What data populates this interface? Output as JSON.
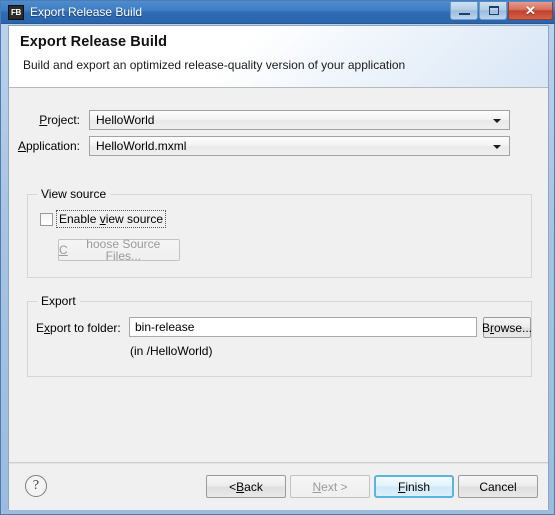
{
  "window": {
    "title": "Export Release Build",
    "icon_label": "FB",
    "icon_name": "flash-builder-icon",
    "controls": {
      "minimize": "minimize-icon",
      "maximize": "restore-icon",
      "close": "✕"
    }
  },
  "banner": {
    "title": "Export Release Build",
    "subtitle": "Build and export an optimized release-quality version of your application"
  },
  "form": {
    "project": {
      "label_pre": "",
      "label_mnemonic": "P",
      "label_post": "roject:",
      "value": "HelloWorld"
    },
    "application": {
      "label_pre": "",
      "label_mnemonic": "A",
      "label_post": "pplication:",
      "value": "HelloWorld.mxml"
    }
  },
  "view_source": {
    "legend": "View source",
    "checkbox": {
      "label_pre": "Enable ",
      "label_mnemonic": "v",
      "label_post": "iew source",
      "checked": false
    },
    "choose_button": {
      "label_pre": "",
      "label_mnemonic": "C",
      "label_post": "hoose Source Files...",
      "enabled": false
    }
  },
  "export": {
    "legend": "Export",
    "folder_label_pre": "E",
    "folder_label_mnemonic": "x",
    "folder_label_post": "port to folder:",
    "folder_value": "bin-release",
    "browse_pre": "B",
    "browse_mnemonic": "r",
    "browse_post": "owse...",
    "hint": "(in /HelloWorld)"
  },
  "footer": {
    "help": "?",
    "back_pre": "< ",
    "back_mnemonic": "B",
    "back_post": "ack",
    "next_pre": "",
    "next_mnemonic": "N",
    "next_post": "ext >",
    "finish_pre": "",
    "finish_mnemonic": "F",
    "finish_post": "inish",
    "cancel": "Cancel"
  },
  "colors": {
    "titlebar_blue": "#3c7cc2",
    "close_red": "#c1412b",
    "default_button_glow": "#5ab4e0",
    "dialog_bg": "#f0f0f0"
  }
}
